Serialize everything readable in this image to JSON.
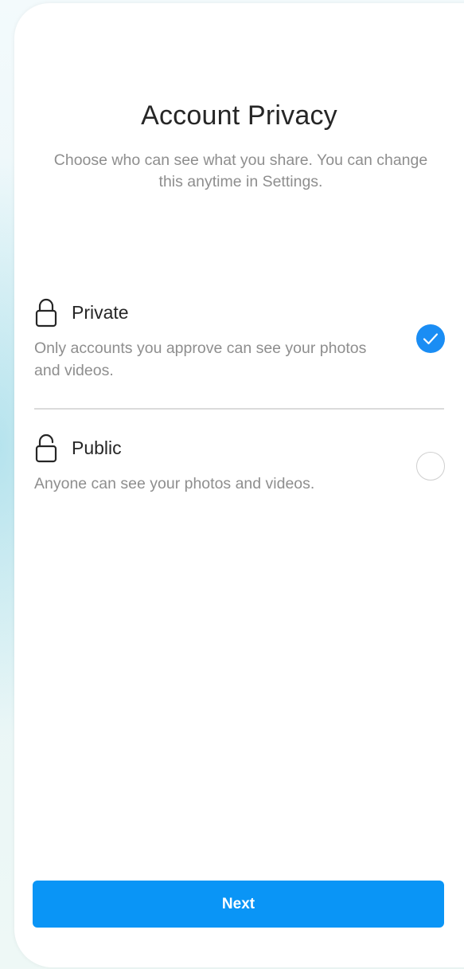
{
  "screen": {
    "title": "Account Privacy",
    "subtitle": "Choose who can see what you share. You can change this anytime in Settings."
  },
  "options": [
    {
      "id": "private",
      "icon": "lock-closed-icon",
      "label": "Private",
      "description": "Only accounts you approve can see your photos and videos.",
      "selected": true
    },
    {
      "id": "public",
      "icon": "lock-open-icon",
      "label": "Public",
      "description": "Anyone can see your photos and videos.",
      "selected": false
    }
  ],
  "footer": {
    "next_label": "Next"
  },
  "colors": {
    "accent": "#0a95f6",
    "check_fill": "#1a8df4",
    "primary_text": "#262626",
    "secondary_text": "#8e8e8e",
    "divider": "#dbdbdb"
  }
}
